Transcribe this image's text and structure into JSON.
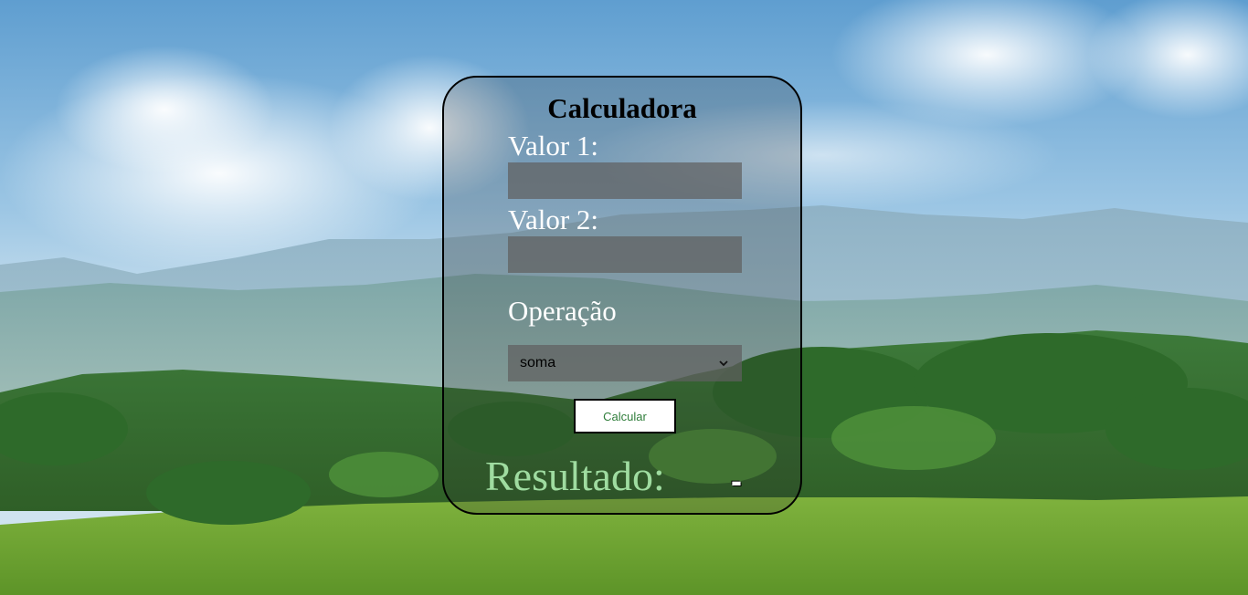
{
  "calculator": {
    "title": "Calculadora",
    "value1_label": "Valor 1:",
    "value1_value": "",
    "value2_label": "Valor 2:",
    "value2_value": "",
    "operation_label": "Operação",
    "operation_selected": "soma",
    "calculate_button": "Calcular",
    "result_label": "Resultado:",
    "result_value": "-"
  },
  "colors": {
    "result_label": "#9fdca0",
    "button_text": "#2f7d3a",
    "card_border": "#000000"
  },
  "icons": {
    "select_arrow": "chevron-down-icon"
  }
}
